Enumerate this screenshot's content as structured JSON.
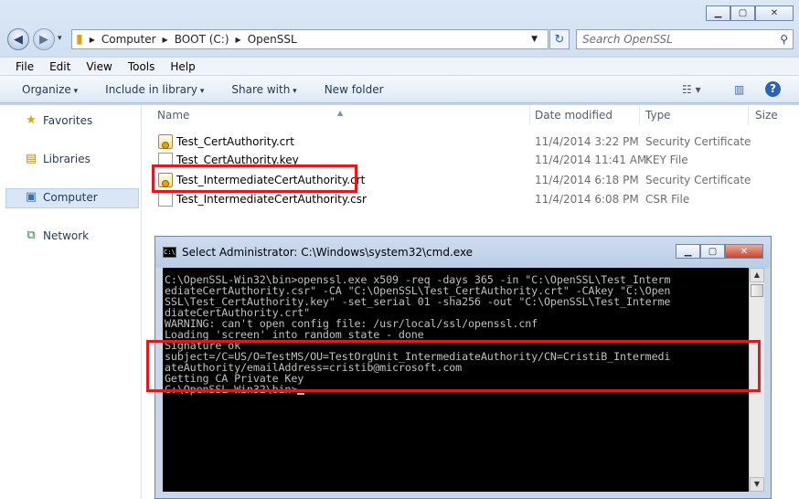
{
  "window": {
    "caption_buttons": [
      "minimize-icon",
      "maximize-icon",
      "close-icon"
    ]
  },
  "address": {
    "crumbs": [
      "Computer",
      "BOOT (C:)",
      "OpenSSL"
    ],
    "search_placeholder": "Search OpenSSL"
  },
  "menu": [
    "File",
    "Edit",
    "View",
    "Tools",
    "Help"
  ],
  "commands": {
    "organize": "Organize",
    "include": "Include in library",
    "share": "Share with",
    "new_folder": "New folder"
  },
  "navpane": {
    "favorites": "Favorites",
    "libraries": "Libraries",
    "computer": "Computer",
    "network": "Network"
  },
  "columns": {
    "name": "Name",
    "date": "Date modified",
    "type": "Type",
    "size": "Size"
  },
  "files": [
    {
      "name": "Test_CertAuthority.crt",
      "date": "11/4/2014 3:22 PM",
      "type": "Security Certificate",
      "icon": "certificate-icon"
    },
    {
      "name": "Test_CertAuthority.key",
      "date": "11/4/2014 11:41 AM",
      "type": "KEY File",
      "icon": "document-icon"
    },
    {
      "name": "Test_IntermediateCertAuthority.crt",
      "date": "11/4/2014 6:18 PM",
      "type": "Security Certificate",
      "icon": "certificate-icon"
    },
    {
      "name": "Test_IntermediateCertAuthority.csr",
      "date": "11/4/2014 6:08 PM",
      "type": "CSR File",
      "icon": "document-icon"
    }
  ],
  "cmd": {
    "icon_label": "C:\\",
    "title": "Select Administrator: C:\\Windows\\system32\\cmd.exe",
    "lines": [
      "C:\\OpenSSL-Win32\\bin>openssl.exe x509 -req -days 365 -in \"C:\\OpenSSL\\Test_Interm",
      "ediateCertAuthority.csr\" -CA \"C:\\OpenSSL\\Test_CertAuthority.crt\" -CAkey \"C:\\Open",
      "SSL\\Test_CertAuthority.key\" -set_serial 01 -sha256 -out \"C:\\OpenSSL\\Test_Interme",
      "diateCertAuthority.crt\"",
      "WARNING: can't open config file: /usr/local/ssl/openssl.cnf",
      "Loading 'screen' into random state - done",
      "Signature ok",
      "subject=/C=US/O=TestMS/OU=TestOrgUnit_IntermediateAuthority/CN=CristiB_Intermedi",
      "ateAuthority/emailAddress=cristib@microsoft.com",
      "Getting CA Private Key",
      "",
      "C:\\OpenSSL-Win32\\bin>"
    ]
  }
}
